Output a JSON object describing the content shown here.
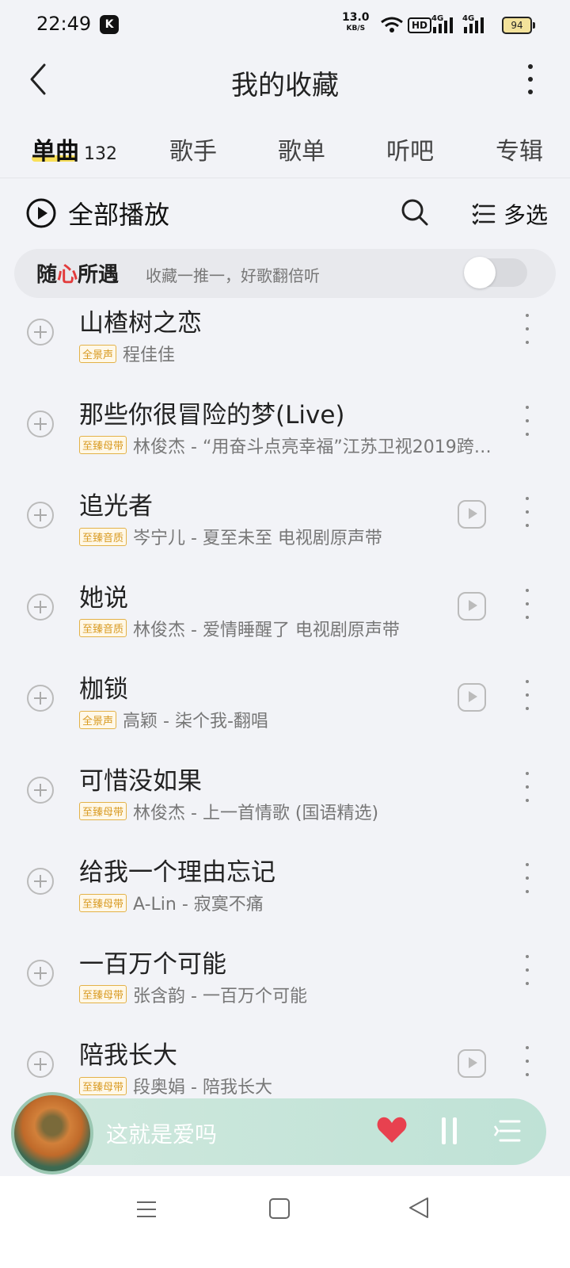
{
  "status_bar": {
    "time": "22:49",
    "app_badge": "K",
    "net_speed": "13.0",
    "net_speed_unit": "KB/S",
    "hd": "HD",
    "sig1": "4G",
    "sig2": "4G",
    "battery": "94"
  },
  "header": {
    "title": "我的收藏"
  },
  "tabs": [
    {
      "label": "单曲",
      "count": "132"
    },
    {
      "label": "歌手"
    },
    {
      "label": "歌单"
    },
    {
      "label": "听吧"
    },
    {
      "label": "专辑"
    }
  ],
  "actions": {
    "play_all": "全部播放",
    "multi_select": "多选"
  },
  "encounter": {
    "title_a": "随",
    "title_heart": "心",
    "title_b": "所遇",
    "subtitle": "收藏一推一，好歌翻倍听"
  },
  "songs": [
    {
      "title": "山楂树之恋",
      "tag": "全景声",
      "sub": "程佳佳",
      "mv": false
    },
    {
      "title": "那些你很冒险的梦(Live)",
      "tag": "至臻母带",
      "sub": "林俊杰 - “用奋斗点亮幸福”江苏卫视2019跨…",
      "mv": false
    },
    {
      "title": "追光者",
      "tag": "至臻音质",
      "sub": "岑宁儿 - 夏至未至 电视剧原声带",
      "mv": true
    },
    {
      "title": "她说",
      "tag": "至臻音质",
      "sub": "林俊杰 - 爱情睡醒了 电视剧原声带",
      "mv": true
    },
    {
      "title": "枷锁",
      "tag": "全景声",
      "sub": "高颖 - 柒个我-翻唱",
      "mv": true
    },
    {
      "title": "可惜没如果",
      "tag": "至臻母带",
      "sub": "林俊杰 - 上一首情歌 (国语精选)",
      "mv": false
    },
    {
      "title": "给我一个理由忘记",
      "tag": "至臻母带",
      "sub": "A-Lin - 寂寞不痛",
      "mv": false
    },
    {
      "title": "一百万个可能",
      "tag": "至臻母带",
      "sub": "张含韵 - 一百万个可能",
      "mv": false
    },
    {
      "title": "陪我长大",
      "tag": "至臻母带",
      "sub": "段奥娟 - 陪我长大",
      "mv": true
    }
  ],
  "player": {
    "song_name": "这就是爱吗",
    "liked": true,
    "accent": "#e8414f"
  },
  "colors": {
    "tab_underline": "#f9e05a",
    "tag_text": "#d89a22"
  }
}
